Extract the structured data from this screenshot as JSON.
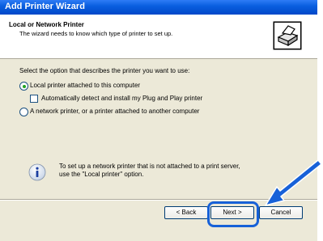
{
  "window": {
    "title": "Add Printer Wizard"
  },
  "header": {
    "title": "Local or Network Printer",
    "subtitle": "The wizard needs to know which type of printer to set up.",
    "icon": "printer-icon"
  },
  "main": {
    "instruction": "Select the option that describes the printer you want to use:",
    "options": [
      {
        "label": "Local printer attached to this computer",
        "selected": true
      },
      {
        "label": "A network printer, or a printer attached to another computer",
        "selected": false
      }
    ],
    "checkbox": {
      "label": "Automatically detect and install my Plug and Play printer",
      "checked": false
    },
    "info": {
      "line1": "To set up a network printer that is not attached to a print server,",
      "line2": "use the \"Local printer\" option."
    }
  },
  "buttons": {
    "back": "< Back",
    "next": "Next >",
    "cancel": "Cancel"
  },
  "colors": {
    "titlebar": "#0a5fe0",
    "highlight": "#1761d8"
  }
}
